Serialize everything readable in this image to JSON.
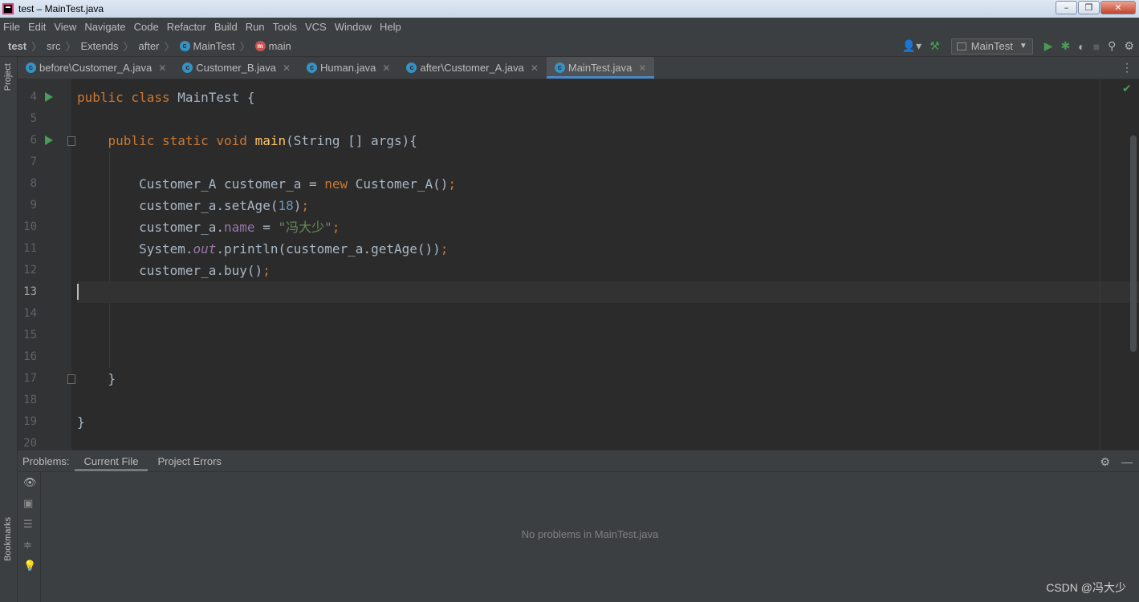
{
  "window": {
    "title": "test – MainTest.java"
  },
  "menu": [
    "File",
    "Edit",
    "View",
    "Navigate",
    "Code",
    "Refactor",
    "Build",
    "Run",
    "Tools",
    "VCS",
    "Window",
    "Help"
  ],
  "breadcrumb": {
    "project": "test",
    "folder1": "src",
    "folder2": "Extends",
    "folder3": "after",
    "class": "MainTest",
    "method": "main"
  },
  "run_config": "MainTest",
  "tabs": [
    {
      "label": "before\\Customer_A.java",
      "active": false
    },
    {
      "label": "Customer_B.java",
      "active": false
    },
    {
      "label": "Human.java",
      "active": false
    },
    {
      "label": "after\\Customer_A.java",
      "active": false
    },
    {
      "label": "MainTest.java",
      "active": true
    }
  ],
  "side_labels": {
    "project": "Project",
    "bookmarks": "Bookmarks"
  },
  "editor": {
    "line_numbers": [
      "4",
      "5",
      "6",
      "7",
      "8",
      "9",
      "10",
      "11",
      "12",
      "13",
      "14",
      "15",
      "16",
      "17",
      "18",
      "19",
      "20"
    ],
    "current_line": "13"
  },
  "problems": {
    "label": "Problems:",
    "tab_current_file": "Current File",
    "tab_project_errors": "Project Errors",
    "empty_message": "No problems in MainTest.java"
  },
  "watermark": "CSDN @冯大少",
  "colors": {
    "keyword": "#cc7832",
    "method": "#ffc66d",
    "number": "#6897bb",
    "string": "#6a8759",
    "field": "#9876aa",
    "accent": "#4a88c7"
  }
}
